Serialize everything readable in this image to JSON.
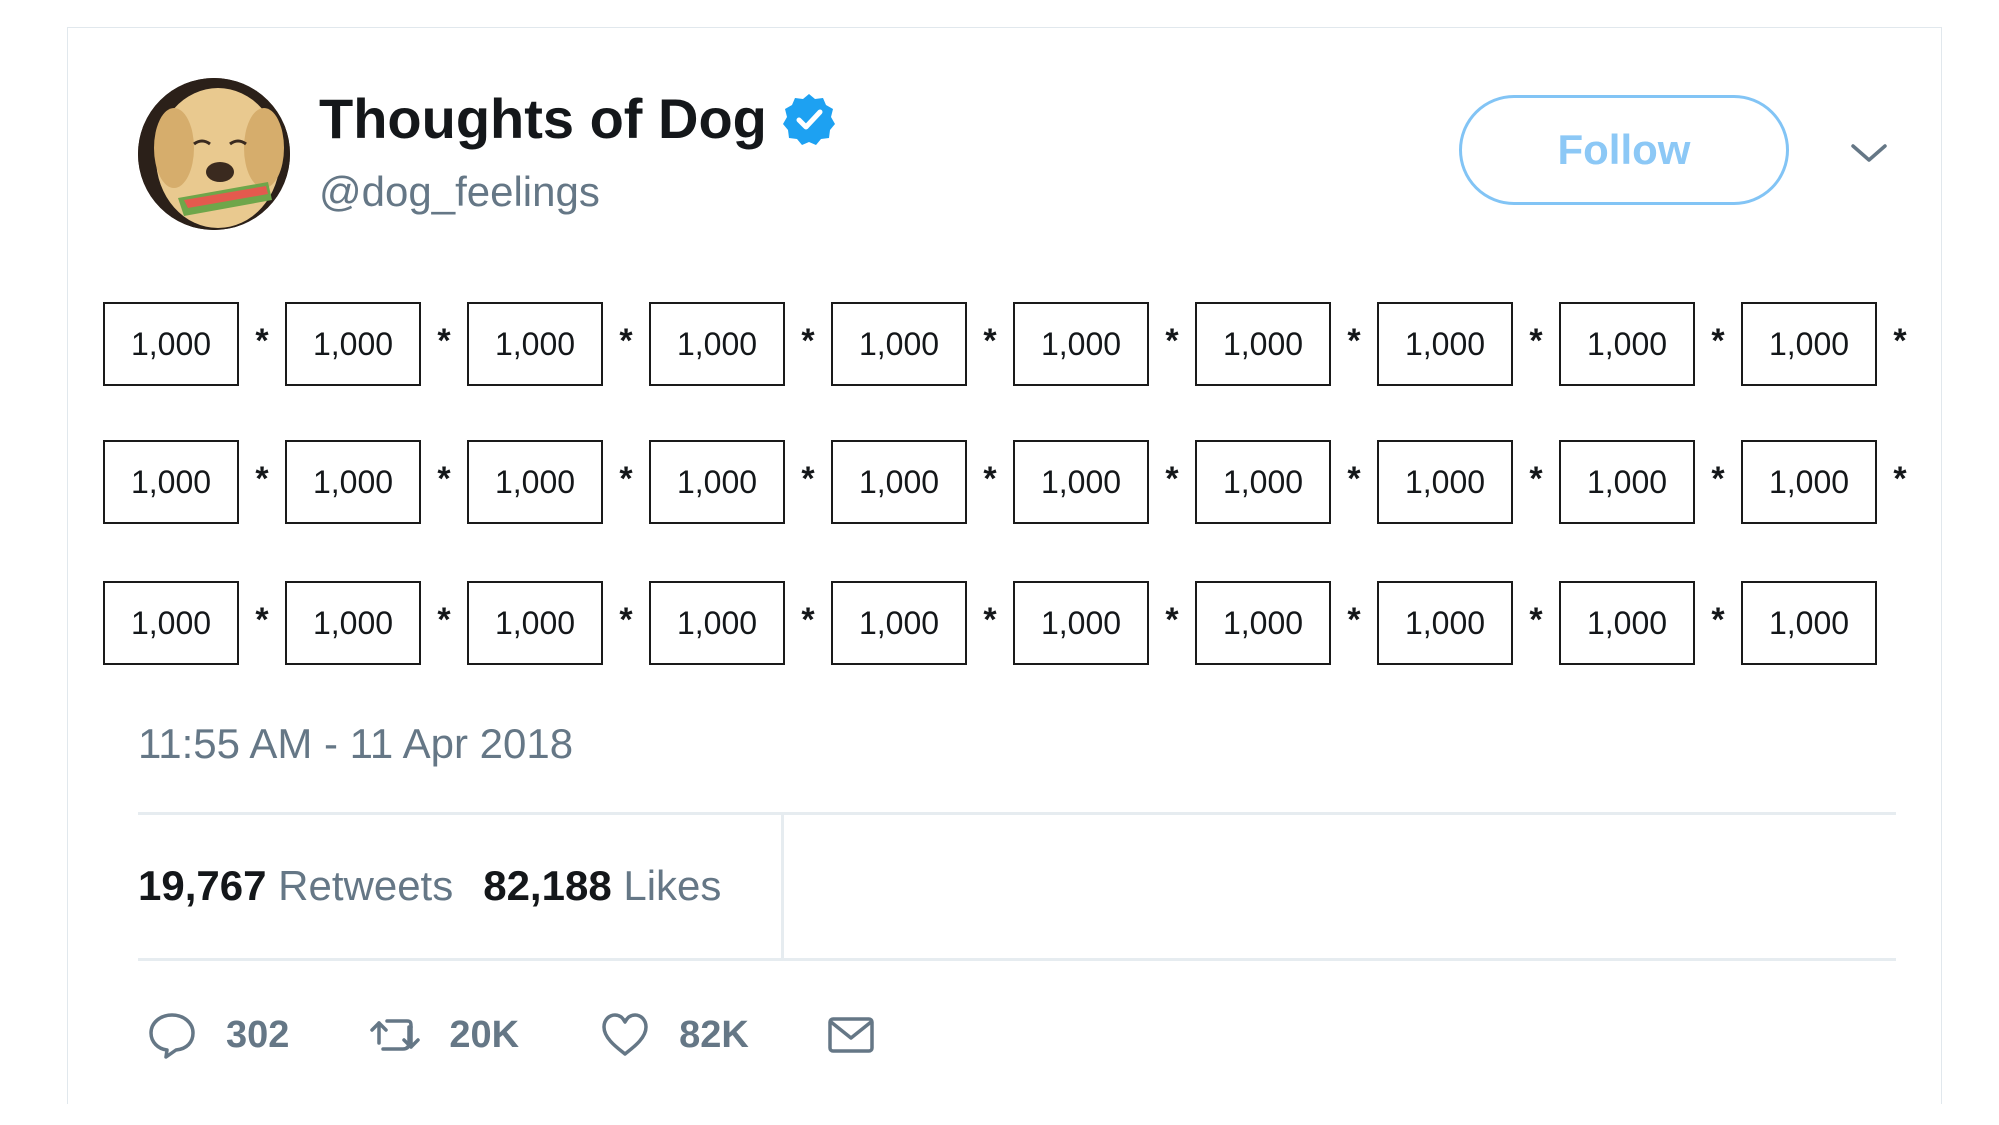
{
  "profile": {
    "display_name": "Thoughts of Dog",
    "handle": "@dog_feelings",
    "follow_label": "Follow"
  },
  "tweet": {
    "rows": [
      {
        "values": [
          "1,000",
          "1,000",
          "1,000",
          "1,000",
          "1,000",
          "1,000",
          "1,000",
          "1,000",
          "1,000",
          "1,000"
        ],
        "operators": [
          "*",
          "*",
          "*",
          "*",
          "*",
          "*",
          "*",
          "*",
          "*",
          "*"
        ]
      },
      {
        "values": [
          "1,000",
          "1,000",
          "1,000",
          "1,000",
          "1,000",
          "1,000",
          "1,000",
          "1,000",
          "1,000",
          "1,000"
        ],
        "operators": [
          "*",
          "*",
          "*",
          "*",
          "*",
          "*",
          "*",
          "*",
          "*",
          "*"
        ]
      },
      {
        "values": [
          "1,000",
          "1,000",
          "1,000",
          "1,000",
          "1,000",
          "1,000",
          "1,000",
          "1,000",
          "1,000",
          "1,000"
        ],
        "operators": [
          "*",
          "*",
          "*",
          "*",
          "*",
          "*",
          "*",
          "*",
          "*"
        ]
      }
    ],
    "timestamp": "11:55 AM - 11 Apr 2018"
  },
  "stats": {
    "retweets_count": "19,767",
    "retweets_label": "Retweets",
    "likes_count": "82,188",
    "likes_label": "Likes"
  },
  "actions": {
    "reply_count": "302",
    "retweet_count": "20K",
    "like_count": "82K"
  },
  "colors": {
    "accent": "#1da1f2",
    "follow_border": "#82c4f5",
    "muted_text": "#657786",
    "divider": "#e6ecf0"
  },
  "icons": [
    "verified-badge-icon",
    "chevron-down-icon",
    "reply-icon",
    "retweet-icon",
    "heart-icon",
    "mail-icon"
  ]
}
